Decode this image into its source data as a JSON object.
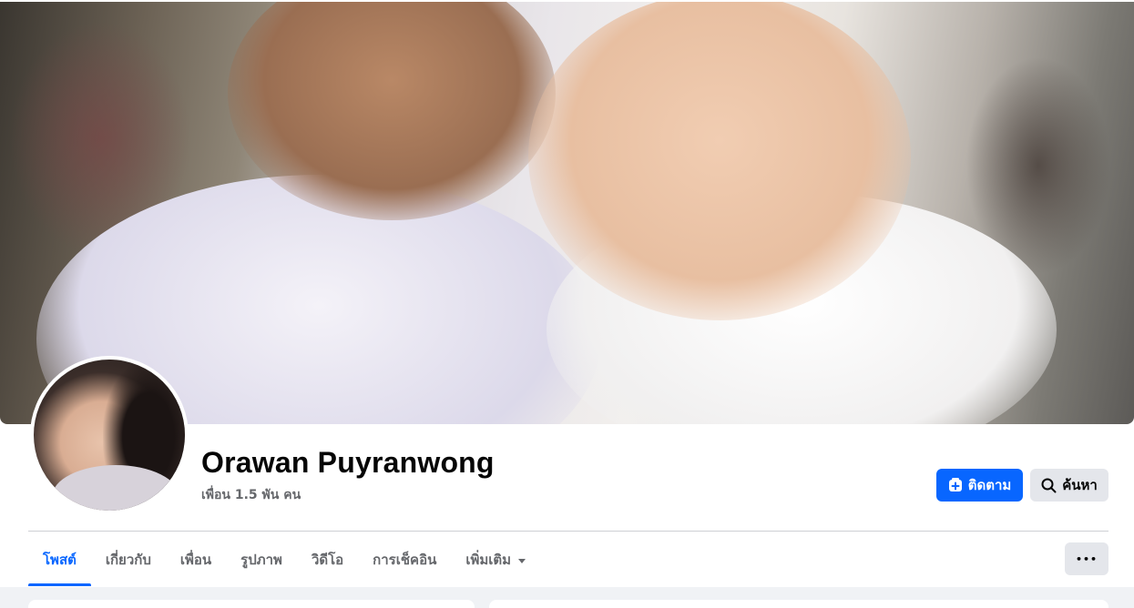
{
  "profile": {
    "name": "Orawan Puyranwong",
    "friends_count": "เพื่อน 1.5 พัน คน"
  },
  "actions": {
    "follow_label": "ติดตาม",
    "search_label": "ค้นหา",
    "more_label": "•••"
  },
  "tabs": [
    {
      "label": "โพสต์",
      "active": true
    },
    {
      "label": "เกี่ยวกับ",
      "active": false
    },
    {
      "label": "เพื่อน",
      "active": false
    },
    {
      "label": "รูปภาพ",
      "active": false
    },
    {
      "label": "วิดีโอ",
      "active": false
    },
    {
      "label": "การเช็คอิน",
      "active": false
    },
    {
      "label": "เพิ่มเติม",
      "active": false
    }
  ],
  "colors": {
    "accent": "#0866ff",
    "secondary_button": "#e4e6eb",
    "muted_text": "#65676b",
    "page_bg": "#f0f2f5"
  }
}
